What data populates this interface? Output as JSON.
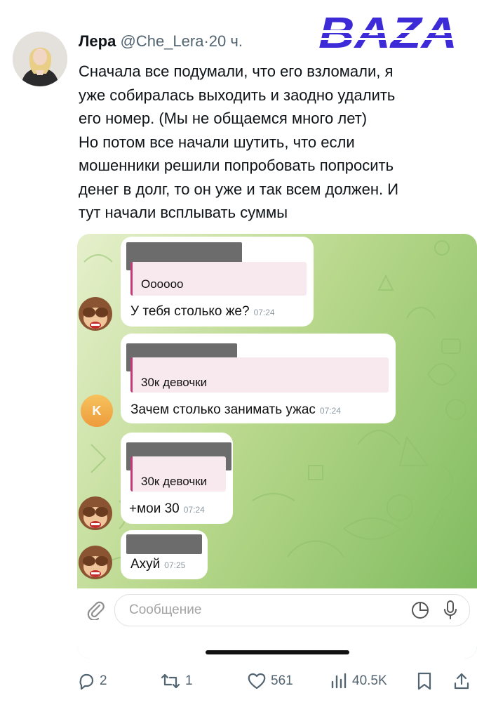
{
  "tweet": {
    "author_name": "Лера",
    "handle": "@Che_Lera",
    "separator": "·",
    "time": "20 ч.",
    "lines": [
      "Сначала все подумали, что его взломали, я",
      "уже собиралась выходить и заодно удалить",
      "его номер. (Мы не общаемся много лет)",
      "Но потом все начали шутить, что если",
      "мошенники решили попробовать попросить",
      "денег в долг, то он уже и так всем должен. И",
      "тут начали всплывать суммы"
    ]
  },
  "watermark": {
    "text": "BAZA",
    "color": "#3d2bd8"
  },
  "chat": {
    "messages": [
      {
        "quote": "Оооооо",
        "text": "У тебя столько же?",
        "time": "07:24",
        "avatar": "monkey-see-no-evil"
      },
      {
        "quote": "30к девочки",
        "text": "Зачем столько занимать ужас",
        "time": "07:24",
        "avatar_letter": "K"
      },
      {
        "quote": "30к девочки",
        "text": "+мои 30",
        "time": "07:24",
        "avatar": "monkey-see-no-evil"
      },
      {
        "text": "Ахуй",
        "time": "07:25",
        "avatar": "monkey-see-no-evil"
      }
    ],
    "input_placeholder": "Сообщение",
    "accent_color": "#c33a78"
  },
  "actions": {
    "replies": "2",
    "reposts": "1",
    "likes": "561",
    "views": "40.5K"
  }
}
